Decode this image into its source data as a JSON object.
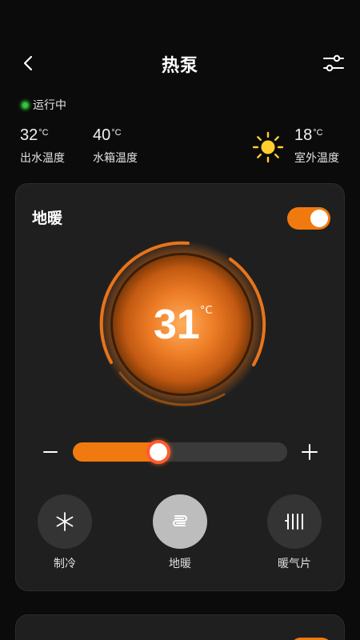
{
  "header": {
    "title": "热泵"
  },
  "status": {
    "text": "运行中",
    "color": "#35c63f"
  },
  "temps": {
    "outlet": {
      "value": "32",
      "unit": "°C",
      "label": "出水温度"
    },
    "tank": {
      "value": "40",
      "unit": "°C",
      "label": "水箱温度"
    },
    "outdoor": {
      "value": "18",
      "unit": "°C",
      "label": "室外温度",
      "icon": "sun-icon"
    }
  },
  "card": {
    "title": "地暖",
    "toggle_on": true,
    "setpoint": {
      "value": "31",
      "unit": "°C"
    },
    "slider_fraction": 0.4,
    "accent": "#f07a10",
    "modes": [
      {
        "label": "制冷",
        "icon": "snowflake-icon",
        "active": false
      },
      {
        "label": "地暖",
        "icon": "floor-heating-icon",
        "active": true
      },
      {
        "label": "暖气片",
        "icon": "radiator-icon",
        "active": false
      }
    ]
  }
}
